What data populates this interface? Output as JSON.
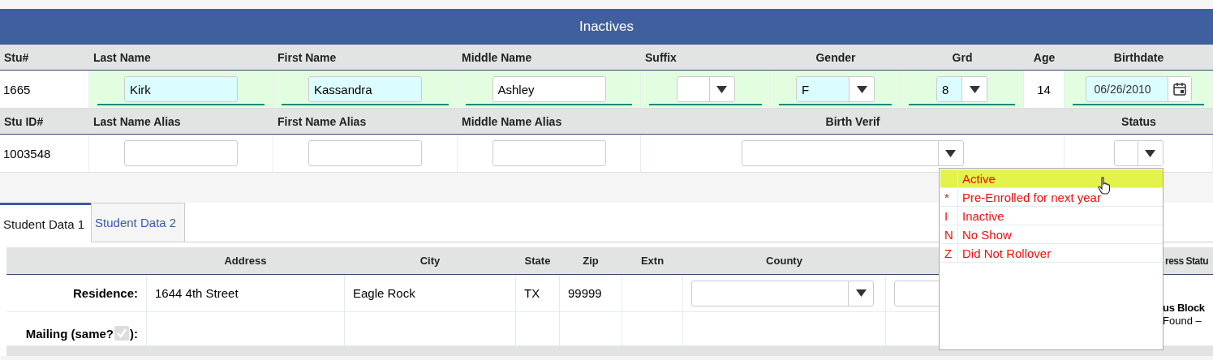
{
  "banner": {
    "title": "Inactives"
  },
  "demographics": [
    {
      "columns": [
        {
          "label": "Stu#",
          "field": {
            "kind": "plain",
            "value": "1665"
          }
        },
        {
          "label": "Last Name",
          "required": true,
          "field": {
            "kind": "text",
            "value": "Kirk",
            "highlighted": true
          }
        },
        {
          "label": "First Name",
          "required": true,
          "field": {
            "kind": "text",
            "value": "Kassandra",
            "highlighted": true
          }
        },
        {
          "label": "Middle Name",
          "required": true,
          "field": {
            "kind": "text",
            "value": "Ashley",
            "highlighted": false
          }
        },
        {
          "label": "Suffix",
          "required": true,
          "field": {
            "kind": "select",
            "highlighted": false
          }
        },
        {
          "label": "Gender",
          "required": true,
          "field": {
            "kind": "select",
            "value": "F",
            "highlighted": true
          }
        },
        {
          "label": "Grd",
          "required": true,
          "field": {
            "kind": "select",
            "value": "8",
            "highlighted": true
          }
        },
        {
          "label": "Age",
          "required": false,
          "field": {
            "kind": "plain",
            "value": "14"
          }
        },
        {
          "label": "Birthdate",
          "required": true,
          "field": {
            "kind": "date",
            "value": "06/26/2010",
            "highlighted": true
          }
        }
      ]
    },
    {
      "columns": [
        {
          "label": "Stu ID#",
          "field": {
            "kind": "plain",
            "value": "1003548"
          }
        },
        {
          "label": "Last Name Alias",
          "field": {
            "kind": "text",
            "highlighted": false
          }
        },
        {
          "label": "First Name Alias",
          "field": {
            "kind": "text",
            "highlighted": false
          }
        },
        {
          "label": "Middle Name Alias",
          "field": {
            "kind": "text",
            "highlighted": false
          }
        },
        {
          "label": "Birth Verif",
          "field": {
            "kind": "select",
            "highlighted": false
          }
        },
        {
          "label": "Status",
          "field": {
            "kind": "select",
            "highlighted": false,
            "expanded": true
          }
        }
      ]
    }
  ],
  "status_dropdown": {
    "options": [
      {
        "label": "Active",
        "selected": true
      },
      {
        "code": "*",
        "label": "Pre-Enrolled for next year",
        "selected": false
      },
      {
        "code": "I",
        "label": "Inactive",
        "selected": false
      },
      {
        "code": "N",
        "label": "No Show",
        "selected": false
      },
      {
        "code": "Z",
        "label": "Did Not Rollover",
        "selected": false
      }
    ]
  },
  "tabs": [
    {
      "label": "Student Data 1",
      "selected": true
    },
    {
      "label": "Student Data 2",
      "selected": false
    }
  ],
  "address": {
    "columns": [
      "Address",
      "City",
      "State",
      "Zip",
      "Extn",
      "County"
    ],
    "column_8": "ress Statu",
    "residence": {
      "label": "Residence:",
      "address": "1644 4th Street",
      "city": "Eagle Rock",
      "state": "TX",
      "zip": "99999"
    },
    "mailing": {
      "label": "Mailing (same?",
      "label_end": "):",
      "same_checked": true,
      "same_disabled": true
    },
    "side_note": {
      "title": "us Block",
      "text": "Found –"
    }
  }
}
